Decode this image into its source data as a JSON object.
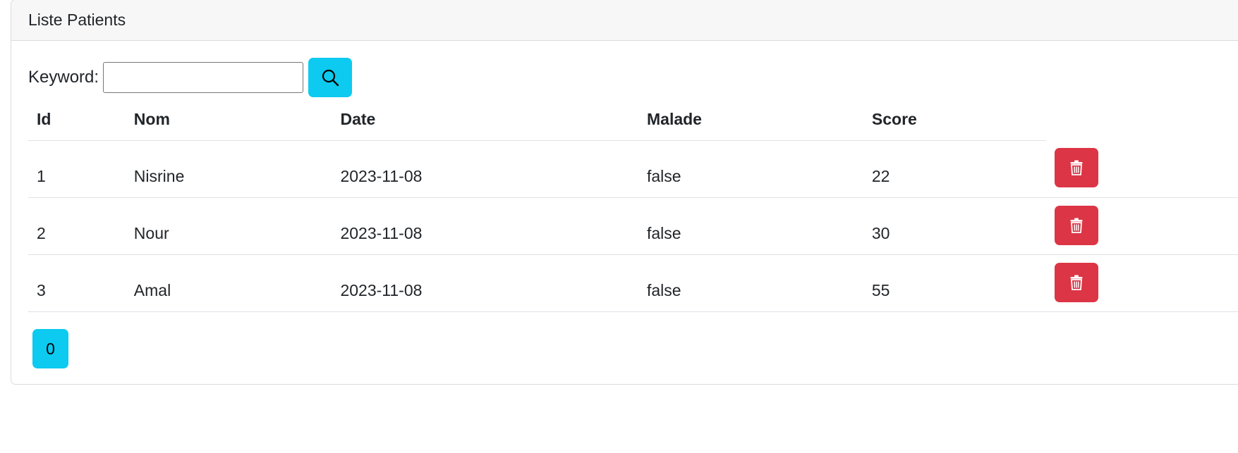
{
  "card": {
    "title": "Liste Patients"
  },
  "search": {
    "label": "Keyword:",
    "value": "",
    "placeholder": "",
    "button_icon": "search-icon"
  },
  "table": {
    "headers": [
      "Id",
      "Nom",
      "Date",
      "Malade",
      "Score"
    ],
    "rows": [
      {
        "id": "1",
        "nom": "Nisrine",
        "date": "2023-11-08",
        "malade": "false",
        "score": "22"
      },
      {
        "id": "2",
        "nom": "Nour",
        "date": "2023-11-08",
        "malade": "false",
        "score": "30"
      },
      {
        "id": "3",
        "nom": "Amal",
        "date": "2023-11-08",
        "malade": "false",
        "score": "55"
      }
    ],
    "row_action_icon": "trash-icon"
  },
  "pagination": {
    "pages": [
      "0"
    ]
  },
  "colors": {
    "info": "#0dcaf0",
    "danger": "#dc3545",
    "header_bg": "#f7f7f7"
  }
}
